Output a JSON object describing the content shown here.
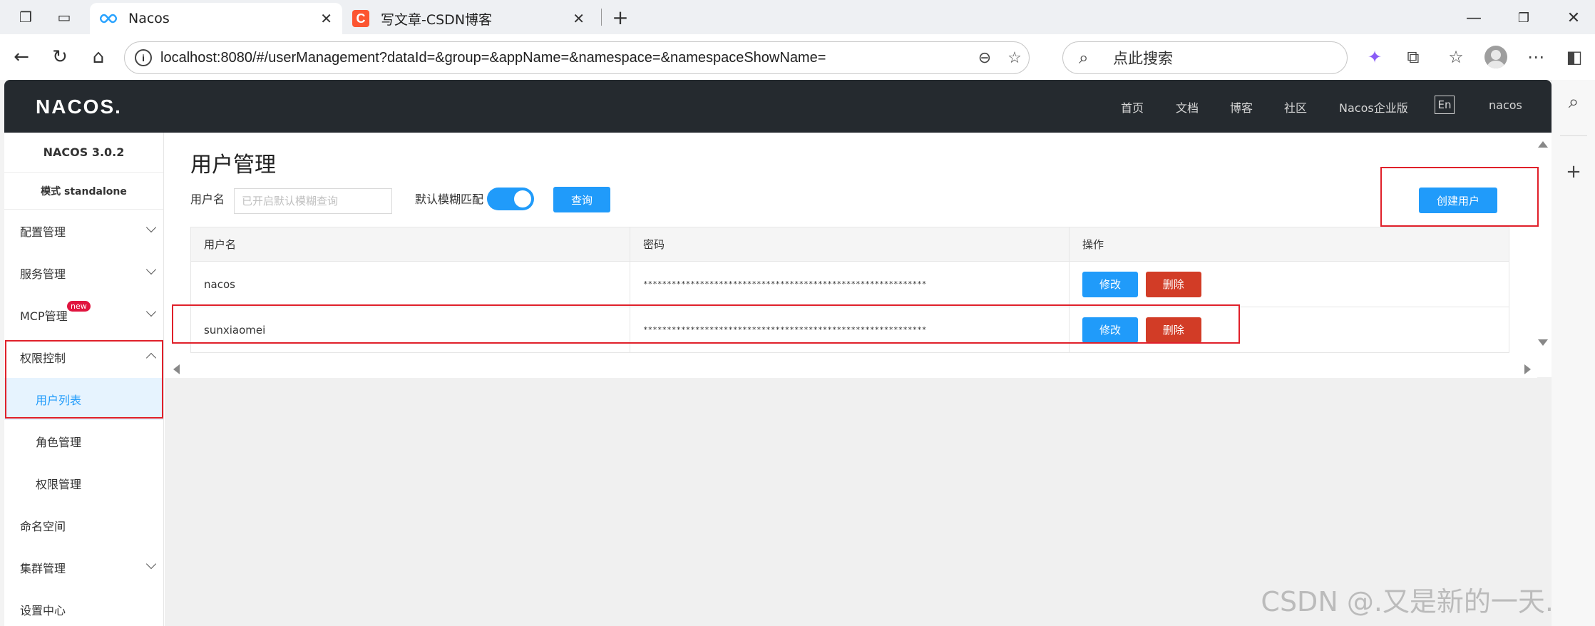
{
  "browser": {
    "tabs": [
      {
        "title": "Nacos",
        "active": true,
        "icon": "nacos-infinity-icon"
      },
      {
        "title": "写文章-CSDN博客",
        "active": false,
        "icon": "csdn-icon",
        "icon_letter": "C"
      }
    ],
    "url": "localhost:8080/#/userManagement?dataId=&group=&appName=&namespace=&namespaceShowName=",
    "search_placeholder": "点此搜索",
    "lang_label": "En"
  },
  "header": {
    "logo_text": "NACOS.",
    "nav": [
      "首页",
      "文档",
      "博客",
      "社区",
      "Nacos企业版"
    ],
    "user": "nacos"
  },
  "sidebar": {
    "version": "NACOS 3.0.2",
    "mode": "模式 standalone",
    "items": [
      {
        "label": "配置管理",
        "has_chevron": true
      },
      {
        "label": "服务管理",
        "has_chevron": true
      },
      {
        "label": "MCP管理",
        "has_chevron": true,
        "badge": "new"
      },
      {
        "label": "权限控制",
        "has_chevron": true,
        "expanded": true,
        "children": [
          {
            "label": "用户列表",
            "selected": true
          },
          {
            "label": "角色管理"
          },
          {
            "label": "权限管理"
          }
        ]
      },
      {
        "label": "命名空间",
        "has_chevron": false
      },
      {
        "label": "集群管理",
        "has_chevron": true
      },
      {
        "label": "设置中心",
        "has_chevron": false
      }
    ]
  },
  "main": {
    "title": "用户管理",
    "filter": {
      "username_label": "用户名",
      "username_placeholder": "已开启默认模糊查询",
      "fuzzy_label": "默认模糊匹配",
      "fuzzy_on": true,
      "search_button": "查询"
    },
    "create_button": "创建用户",
    "table": {
      "columns": [
        "用户名",
        "密码",
        "操作"
      ],
      "rows": [
        {
          "username": "nacos",
          "password": "************************************************************",
          "edit": "修改",
          "delete": "删除"
        },
        {
          "username": "sunxiaomei",
          "password": "************************************************************",
          "edit": "修改",
          "delete": "删除"
        }
      ]
    }
  },
  "watermark": "CSDN @.又是新的一天.",
  "colors": {
    "primary": "#209bfa",
    "danger": "#d23c26",
    "header_bg": "#252a2f",
    "annotation_red": "#e0202a",
    "selected_bg": "#e6f3fe"
  }
}
